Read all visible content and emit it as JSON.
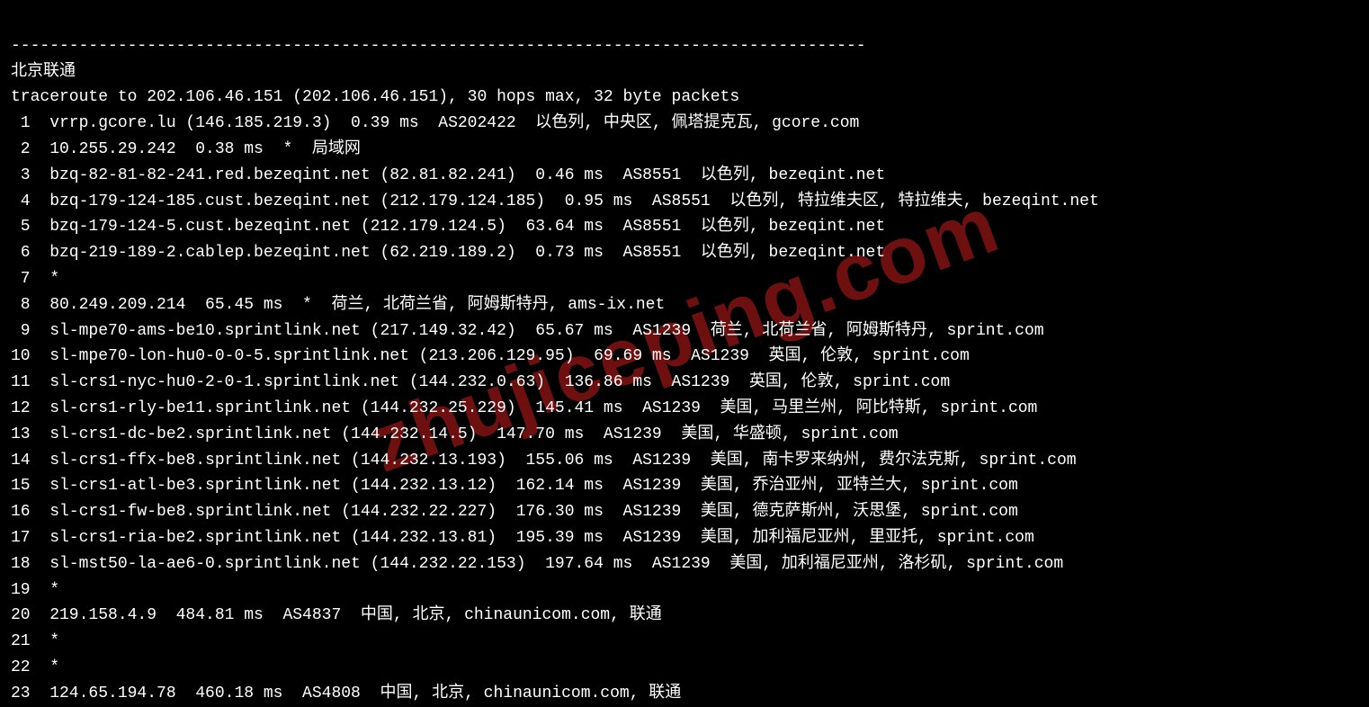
{
  "watermark": "zhujiceping.com",
  "divider": "----------------------------------------------------------------------------------------",
  "title": "北京联通",
  "intro": "traceroute to 202.106.46.151 (202.106.46.151), 30 hops max, 32 byte packets",
  "hops": [
    {
      "n": " 1",
      "rest": "  vrrp.gcore.lu (146.185.219.3)  0.39 ms  AS202422  以色列, 中央区, 佩塔提克瓦, gcore.com"
    },
    {
      "n": " 2",
      "rest": "  10.255.29.242  0.38 ms  *  局域网"
    },
    {
      "n": " 3",
      "rest": "  bzq-82-81-82-241.red.bezeqint.net (82.81.82.241)  0.46 ms  AS8551  以色列, bezeqint.net"
    },
    {
      "n": " 4",
      "rest": "  bzq-179-124-185.cust.bezeqint.net (212.179.124.185)  0.95 ms  AS8551  以色列, 特拉维夫区, 特拉维夫, bezeqint.net"
    },
    {
      "n": " 5",
      "rest": "  bzq-179-124-5.cust.bezeqint.net (212.179.124.5)  63.64 ms  AS8551  以色列, bezeqint.net"
    },
    {
      "n": " 6",
      "rest": "  bzq-219-189-2.cablep.bezeqint.net (62.219.189.2)  0.73 ms  AS8551  以色列, bezeqint.net"
    },
    {
      "n": " 7",
      "rest": "  *"
    },
    {
      "n": " 8",
      "rest": "  80.249.209.214  65.45 ms  *  荷兰, 北荷兰省, 阿姆斯特丹, ams-ix.net"
    },
    {
      "n": " 9",
      "rest": "  sl-mpe70-ams-be10.sprintlink.net (217.149.32.42)  65.67 ms  AS1239  荷兰, 北荷兰省, 阿姆斯特丹, sprint.com"
    },
    {
      "n": "10",
      "rest": "  sl-mpe70-lon-hu0-0-0-5.sprintlink.net (213.206.129.95)  69.69 ms  AS1239  英国, 伦敦, sprint.com"
    },
    {
      "n": "11",
      "rest": "  sl-crs1-nyc-hu0-2-0-1.sprintlink.net (144.232.0.63)  136.86 ms  AS1239  英国, 伦敦, sprint.com"
    },
    {
      "n": "12",
      "rest": "  sl-crs1-rly-be11.sprintlink.net (144.232.25.229)  145.41 ms  AS1239  美国, 马里兰州, 阿比特斯, sprint.com"
    },
    {
      "n": "13",
      "rest": "  sl-crs1-dc-be2.sprintlink.net (144.232.14.5)  147.70 ms  AS1239  美国, 华盛顿, sprint.com"
    },
    {
      "n": "14",
      "rest": "  sl-crs1-ffx-be8.sprintlink.net (144.232.13.193)  155.06 ms  AS1239  美国, 南卡罗来纳州, 费尔法克斯, sprint.com"
    },
    {
      "n": "15",
      "rest": "  sl-crs1-atl-be3.sprintlink.net (144.232.13.12)  162.14 ms  AS1239  美国, 乔治亚州, 亚特兰大, sprint.com"
    },
    {
      "n": "16",
      "rest": "  sl-crs1-fw-be8.sprintlink.net (144.232.22.227)  176.30 ms  AS1239  美国, 德克萨斯州, 沃思堡, sprint.com"
    },
    {
      "n": "17",
      "rest": "  sl-crs1-ria-be2.sprintlink.net (144.232.13.81)  195.39 ms  AS1239  美国, 加利福尼亚州, 里亚托, sprint.com"
    },
    {
      "n": "18",
      "rest": "  sl-mst50-la-ae6-0.sprintlink.net (144.232.22.153)  197.64 ms  AS1239  美国, 加利福尼亚州, 洛杉矶, sprint.com"
    },
    {
      "n": "19",
      "rest": "  *"
    },
    {
      "n": "20",
      "rest": "  219.158.4.9  484.81 ms  AS4837  中国, 北京, chinaunicom.com, 联通"
    },
    {
      "n": "21",
      "rest": "  *"
    },
    {
      "n": "22",
      "rest": "  *"
    },
    {
      "n": "23",
      "rest": "  124.65.194.78  460.18 ms  AS4808  中国, 北京, chinaunicom.com, 联通"
    }
  ]
}
